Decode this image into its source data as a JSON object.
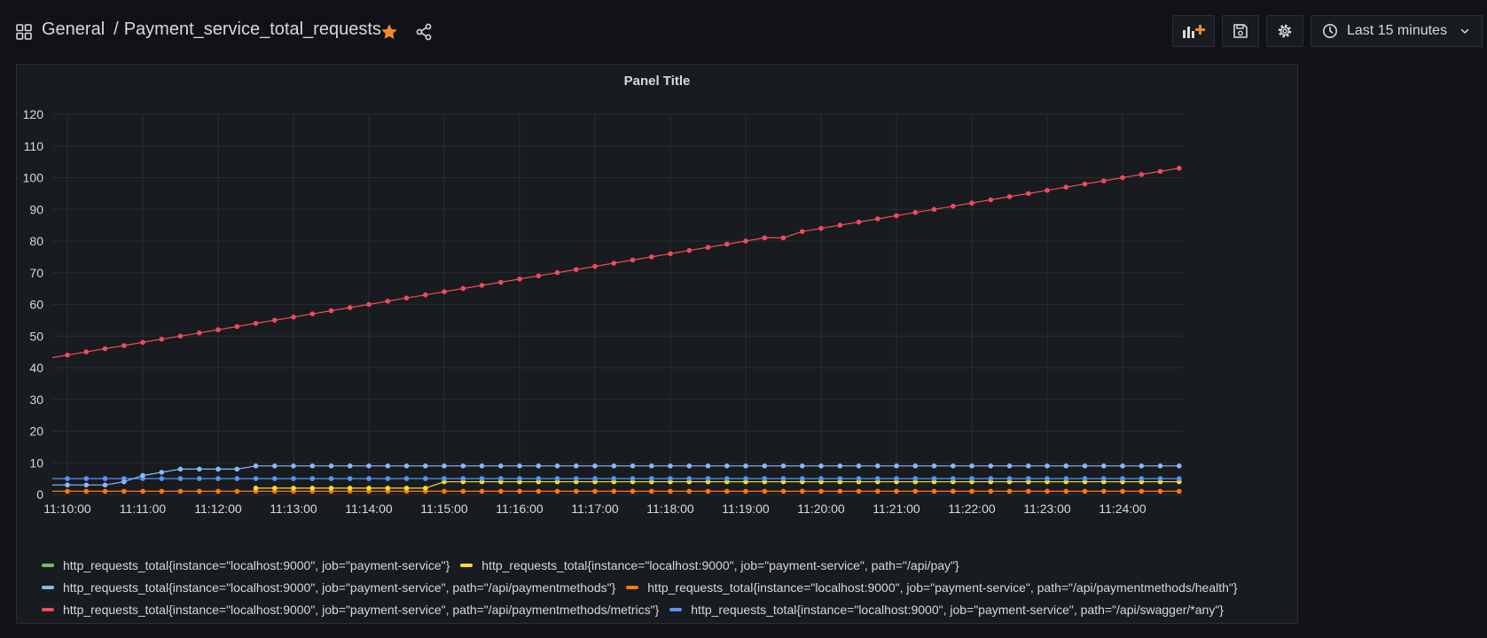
{
  "header": {
    "folder": "General",
    "separator": "/",
    "dashboard_title": "Payment_service_total_requests",
    "icons": [
      "dashboard-grid-icon",
      "star-icon",
      "share-icon",
      "add-panel-icon",
      "save-icon",
      "gear-icon",
      "clock-icon",
      "chevron-down-icon"
    ],
    "star_color": "#f28b24",
    "time_range_label": "Last 15 minutes"
  },
  "panel": {
    "title": "Panel Title"
  },
  "chart_data": {
    "type": "line",
    "title": "Panel Title",
    "xlabel": "",
    "ylabel": "",
    "ylim": [
      0,
      120
    ],
    "yticks": [
      "0",
      "10",
      "20",
      "30",
      "40",
      "50",
      "60",
      "70",
      "80",
      "90",
      "100",
      "110",
      "120"
    ],
    "xlim": [
      "11:09:48",
      "11:24:48"
    ],
    "xticks": [
      "11:10:00",
      "11:11:00",
      "11:12:00",
      "11:13:00",
      "11:14:00",
      "11:15:00",
      "11:16:00",
      "11:17:00",
      "11:18:00",
      "11:19:00",
      "11:20:00",
      "11:21:00",
      "11:22:00",
      "11:23:00",
      "11:24:00"
    ],
    "grid": true,
    "legend_position": "bottom",
    "x": [
      "11:10:00",
      "11:10:15",
      "11:10:30",
      "11:10:45",
      "11:11:00",
      "11:11:15",
      "11:11:30",
      "11:11:45",
      "11:12:00",
      "11:12:15",
      "11:12:30",
      "11:12:45",
      "11:13:00",
      "11:13:15",
      "11:13:30",
      "11:13:45",
      "11:14:00",
      "11:14:15",
      "11:14:30",
      "11:14:45",
      "11:15:00",
      "11:15:15",
      "11:15:30",
      "11:15:45",
      "11:16:00",
      "11:16:15",
      "11:16:30",
      "11:16:45",
      "11:17:00",
      "11:17:15",
      "11:17:30",
      "11:17:45",
      "11:18:00",
      "11:18:15",
      "11:18:30",
      "11:18:45",
      "11:19:00",
      "11:19:15",
      "11:19:30",
      "11:19:45",
      "11:20:00",
      "11:20:15",
      "11:20:30",
      "11:20:45",
      "11:21:00",
      "11:21:15",
      "11:21:30",
      "11:21:45",
      "11:22:00",
      "11:22:15",
      "11:22:30",
      "11:22:45",
      "11:23:00",
      "11:23:15",
      "11:23:30",
      "11:23:45",
      "11:24:00",
      "11:24:15",
      "11:24:30",
      "11:24:45"
    ],
    "series": [
      {
        "name": "http_requests_total{instance=\"localhost:9000\", job=\"payment-service\"}",
        "color": "#73bf69",
        "values": []
      },
      {
        "name": "http_requests_total{instance=\"localhost:9000\", job=\"payment-service\", path=\"/api/pay\"}",
        "color": "#fade2a",
        "values": [
          null,
          null,
          null,
          null,
          null,
          null,
          null,
          null,
          null,
          null,
          2,
          2,
          2,
          2,
          2,
          2,
          2,
          2,
          2,
          2,
          4,
          4,
          4,
          4,
          4,
          4,
          4,
          4,
          4,
          4,
          4,
          4,
          4,
          4,
          4,
          4,
          4,
          4,
          4,
          4,
          4,
          4,
          4,
          4,
          4,
          4,
          4,
          4,
          4,
          4,
          4,
          4,
          4,
          4,
          4,
          4,
          4,
          4,
          4,
          4
        ]
      },
      {
        "name": "http_requests_total{instance=\"localhost:9000\", job=\"payment-service\", path=\"/api/paymentmethods\"}",
        "color": "#8ab8ff",
        "values": [
          3,
          3,
          3,
          4,
          6,
          7,
          8,
          8,
          8,
          8,
          9,
          9,
          9,
          9,
          9,
          9,
          9,
          9,
          9,
          9,
          9,
          9,
          9,
          9,
          9,
          9,
          9,
          9,
          9,
          9,
          9,
          9,
          9,
          9,
          9,
          9,
          9,
          9,
          9,
          9,
          9,
          9,
          9,
          9,
          9,
          9,
          9,
          9,
          9,
          9,
          9,
          9,
          9,
          9,
          9,
          9,
          9,
          9,
          9,
          9
        ]
      },
      {
        "name": "http_requests_total{instance=\"localhost:9000\", job=\"payment-service\", path=\"/api/paymentmethods/health\"}",
        "color": "#ff780a",
        "values": [
          1,
          1,
          1,
          1,
          1,
          1,
          1,
          1,
          1,
          1,
          1,
          1,
          1,
          1,
          1,
          1,
          1,
          1,
          1,
          1,
          1,
          1,
          1,
          1,
          1,
          1,
          1,
          1,
          1,
          1,
          1,
          1,
          1,
          1,
          1,
          1,
          1,
          1,
          1,
          1,
          1,
          1,
          1,
          1,
          1,
          1,
          1,
          1,
          1,
          1,
          1,
          1,
          1,
          1,
          1,
          1,
          1,
          1,
          1,
          1
        ]
      },
      {
        "name": "http_requests_total{instance=\"localhost:9000\", job=\"payment-service\", path=\"/api/paymentmethods/metrics\"}",
        "color": "#f2495c",
        "values": [
          44,
          45,
          46,
          47,
          48,
          49,
          50,
          51,
          52,
          53,
          54,
          55,
          56,
          57,
          58,
          59,
          60,
          61,
          62,
          63,
          64,
          65,
          66,
          67,
          68,
          69,
          70,
          71,
          72,
          73,
          74,
          75,
          76,
          77,
          78,
          79,
          80,
          81,
          81,
          83,
          84,
          85,
          86,
          87,
          88,
          89,
          90,
          91,
          92,
          93,
          94,
          95,
          96,
          97,
          98,
          99,
          100,
          101,
          102,
          103
        ]
      },
      {
        "name": "http_requests_total{instance=\"localhost:9000\", job=\"payment-service\", path=\"/api/swagger/*any\"}",
        "color": "#5794f2",
        "values": [
          5,
          5,
          5,
          5,
          5,
          5,
          5,
          5,
          5,
          5,
          5,
          5,
          5,
          5,
          5,
          5,
          5,
          5,
          5,
          5,
          5,
          5,
          5,
          5,
          5,
          5,
          5,
          5,
          5,
          5,
          5,
          5,
          5,
          5,
          5,
          5,
          5,
          5,
          5,
          5,
          5,
          5,
          5,
          5,
          5,
          5,
          5,
          5,
          5,
          5,
          5,
          5,
          5,
          5,
          5,
          5,
          5,
          5,
          5,
          5
        ]
      }
    ]
  }
}
